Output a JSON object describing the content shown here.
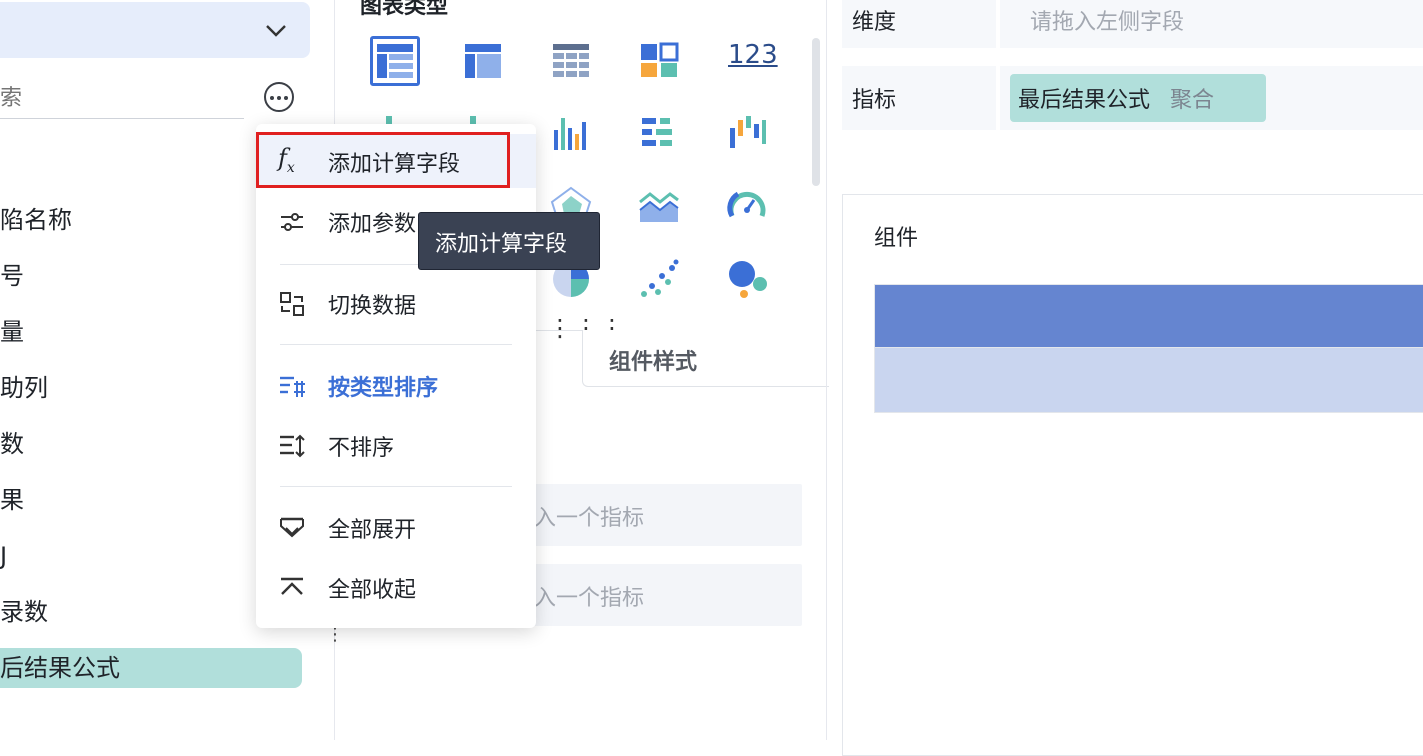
{
  "left_panel": {
    "search_placeholder": "索",
    "fields": [
      {
        "label": "陷名称"
      },
      {
        "label": "号"
      },
      {
        "label": "量"
      },
      {
        "label": "助列"
      },
      {
        "label": "数"
      },
      {
        "label": "果"
      },
      {
        "label": "J"
      },
      {
        "label": "录数"
      },
      {
        "label": "后结果公式"
      }
    ],
    "selected_field_index": 8
  },
  "middle_panel": {
    "chart_type_title": "图表类型",
    "chart_types": [
      "table-icon",
      "cross-table-icon",
      "detail-table-icon",
      "kpi-card-icon",
      "number-icon",
      "column-icon",
      "bar-group-icon",
      "bar-chart-icon",
      "horizontal-bar-icon",
      "waterfall-icon",
      "radar-icon",
      "area-icon",
      "gauge-icon",
      "pie-icon",
      "scatter-icon",
      "bubble-icon"
    ],
    "number_icon_text": "123",
    "more_charts": "⋮⋮⋮",
    "style_tab_label": "组件样式",
    "drop_rows": [
      {
        "placeholder": "入一个指标"
      },
      {
        "placeholder": "入一个指标"
      }
    ]
  },
  "right_panel": {
    "dimension_label": "维度",
    "dimension_placeholder": "请拖入左侧字段",
    "metric_label": "指标",
    "metric_pill": {
      "name": "最后结果公式",
      "aggregation": "聚合"
    },
    "preview_title": "组件",
    "colors": {
      "header": "#6585d0",
      "row": "#c9d5ef",
      "pill": "#b1dfdb",
      "accent": "#3b6fd6"
    }
  },
  "context_menu": {
    "items": [
      {
        "icon": "fx-icon",
        "label": "添加计算字段"
      },
      {
        "icon": "slider-params-icon",
        "label": "添加参数"
      },
      {
        "icon": "switch-data-icon",
        "label": "切换数据"
      },
      {
        "icon": "sort-by-type-icon",
        "label": "按类型排序"
      },
      {
        "icon": "no-sort-icon",
        "label": "不排序"
      },
      {
        "icon": "expand-all-icon",
        "label": "全部展开"
      },
      {
        "icon": "collapse-all-icon",
        "label": "全部收起"
      }
    ],
    "active_index": 3,
    "tooltip": "添加计算字段",
    "highlight_color": "#e02020"
  }
}
